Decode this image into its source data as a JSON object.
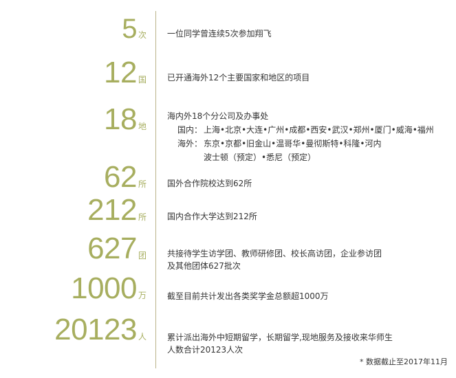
{
  "stats": [
    {
      "number": "5",
      "unit": "次",
      "description": "一位同学曾连续5次参加翔飞"
    },
    {
      "number": "12",
      "unit": "国",
      "description": "已开通海外12个主要国家和地区的项目"
    },
    {
      "number": "18",
      "unit": "地",
      "description": "海内外18个分公司及办事处",
      "domestic_label": "国内：",
      "domestic_cities": "上海•北京•大连•广州•成都•西安•武汉•郑州•厦门•威海•福州",
      "overseas_label": "海外：",
      "overseas_cities_line1": "东京•京都•旧金山•温哥华•曼彻斯特•科隆•河内",
      "overseas_cities_line2": "波士顿（预定）•悉尼（预定）"
    },
    {
      "number": "62",
      "unit": "所",
      "description": "国外合作院校达到62所"
    },
    {
      "number": "212",
      "unit": "所",
      "description": "国内合作大学达到212所"
    },
    {
      "number": "627",
      "unit": "团",
      "description_line1": "共接待学生访学团、教师研修团、校长高访团，企业参访团",
      "description_line2": "及其他团体627批次"
    },
    {
      "number": "1000",
      "unit": "万",
      "description": "截至目前共计发出各类奖学金总额超1000万"
    },
    {
      "number": "20123",
      "unit": "人",
      "description_line1": "累计派出海外中短期留学，长期留学,现地服务及接收来华师生",
      "description_line2": "人数合计20123人次"
    }
  ],
  "footnote": "* 数据截止至2017年11月",
  "colors": {
    "accent": "#a7ae5f",
    "text": "#333333",
    "divider": "#b9b38a"
  }
}
